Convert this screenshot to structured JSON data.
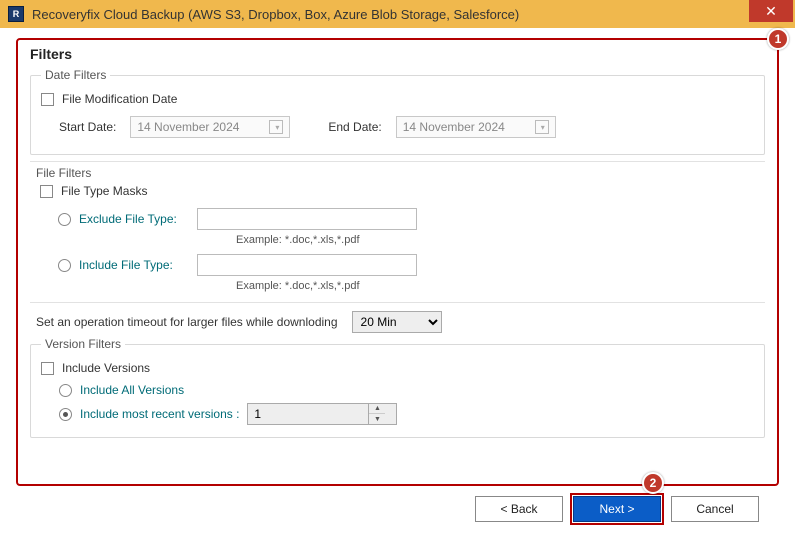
{
  "window": {
    "title": "Recoveryfix Cloud Backup (AWS S3, Dropbox, Box, Azure Blob Storage, Salesforce)",
    "icon_letter": "R"
  },
  "badges": {
    "one": "1",
    "two": "2"
  },
  "filters": {
    "heading": "Filters",
    "date": {
      "legend": "Date Filters",
      "checkbox_label": "File Modification Date",
      "start_label": "Start Date:",
      "start_value": "14 November 2024",
      "end_label": "End Date:",
      "end_value": "14 November 2024"
    },
    "file": {
      "legend": "File Filters",
      "checkbox_label": "File Type Masks",
      "exclude_label": "Exclude File Type:",
      "include_label": "Include File Type:",
      "example": "Example:  *.doc,*.xls,*.pdf"
    },
    "timeout": {
      "label": "Set an operation timeout for larger files while downloding",
      "value": "20 Min"
    },
    "version": {
      "legend": "Version Filters",
      "checkbox_label": "Include Versions",
      "all_label": "Include All Versions",
      "recent_label": "Include most recent versions :",
      "recent_value": "1"
    }
  },
  "buttons": {
    "back": "< Back",
    "next": "Next >",
    "cancel": "Cancel"
  }
}
